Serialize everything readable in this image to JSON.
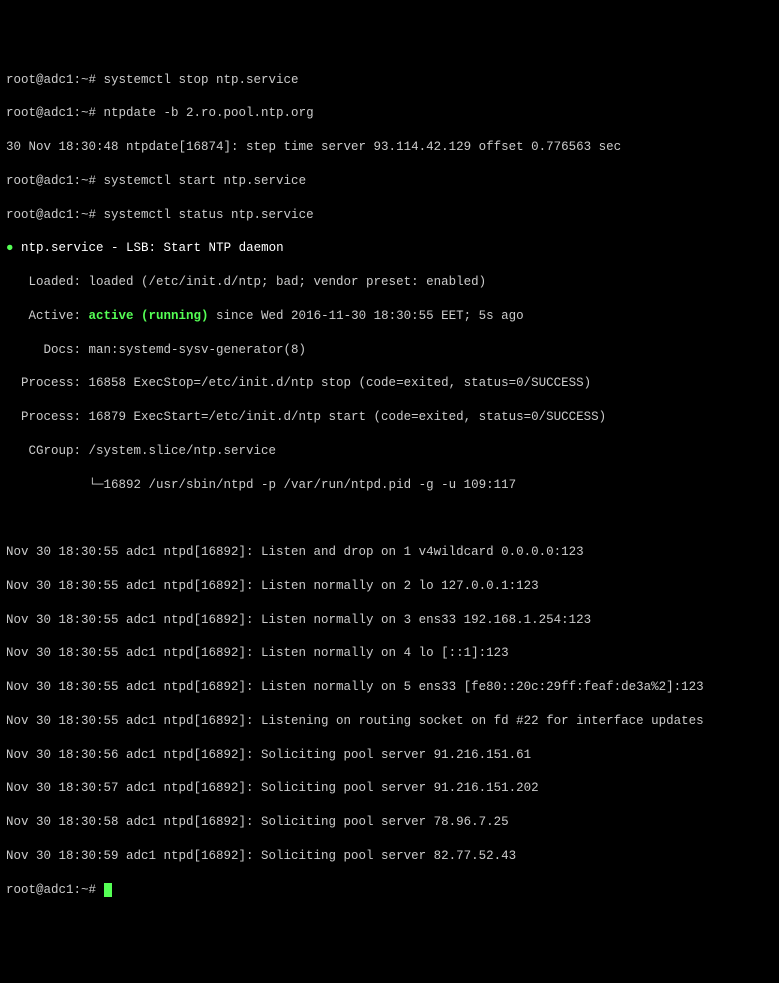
{
  "prompt": "root@adc1:~#",
  "cmd1": "systemctl stop ntp.service",
  "cmd2": "ntpdate -b 2.ro.pool.ntp.org",
  "out1": "30 Nov 18:30:48 ntpdate[16874]: step time server 93.114.42.129 offset 0.776563 sec",
  "cmd3": "systemctl start ntp.service",
  "cmd4": "systemctl status ntp.service",
  "status": {
    "bullet": "●",
    "title": "ntp.service - LSB: Start NTP daemon",
    "loaded": "   Loaded: loaded (/etc/init.d/ntp; bad; vendor preset: enabled)",
    "active_label": "   Active: ",
    "active_value": "active (running)",
    "active_rest": " since Wed 2016-11-30 18:30:55 EET; 5s ago",
    "docs": "     Docs: man:systemd-sysv-generator(8)",
    "proc1": "  Process: 16858 ExecStop=/etc/init.d/ntp stop (code=exited, status=0/SUCCESS)",
    "proc2": "  Process: 16879 ExecStart=/etc/init.d/ntp start (code=exited, status=0/SUCCESS)",
    "cgroup": "   CGroup: /system.slice/ntp.service",
    "cgroup2": "           └─16892 /usr/sbin/ntpd -p /var/run/ntpd.pid -g -u 109:117"
  },
  "logs": [
    "Nov 30 18:30:55 adc1 ntpd[16892]: Listen and drop on 1 v4wildcard 0.0.0.0:123",
    "Nov 30 18:30:55 adc1 ntpd[16892]: Listen normally on 2 lo 127.0.0.1:123",
    "Nov 30 18:30:55 adc1 ntpd[16892]: Listen normally on 3 ens33 192.168.1.254:123",
    "Nov 30 18:30:55 adc1 ntpd[16892]: Listen normally on 4 lo [::1]:123",
    "Nov 30 18:30:55 adc1 ntpd[16892]: Listen normally on 5 ens33 [fe80::20c:29ff:feaf:de3a%2]:123",
    "Nov 30 18:30:55 adc1 ntpd[16892]: Listening on routing socket on fd #22 for interface updates",
    "Nov 30 18:30:56 adc1 ntpd[16892]: Soliciting pool server 91.216.151.61",
    "Nov 30 18:30:57 adc1 ntpd[16892]: Soliciting pool server 91.216.151.202",
    "Nov 30 18:30:58 adc1 ntpd[16892]: Soliciting pool server 78.96.7.25",
    "Nov 30 18:30:59 adc1 ntpd[16892]: Soliciting pool server 82.77.52.43"
  ]
}
